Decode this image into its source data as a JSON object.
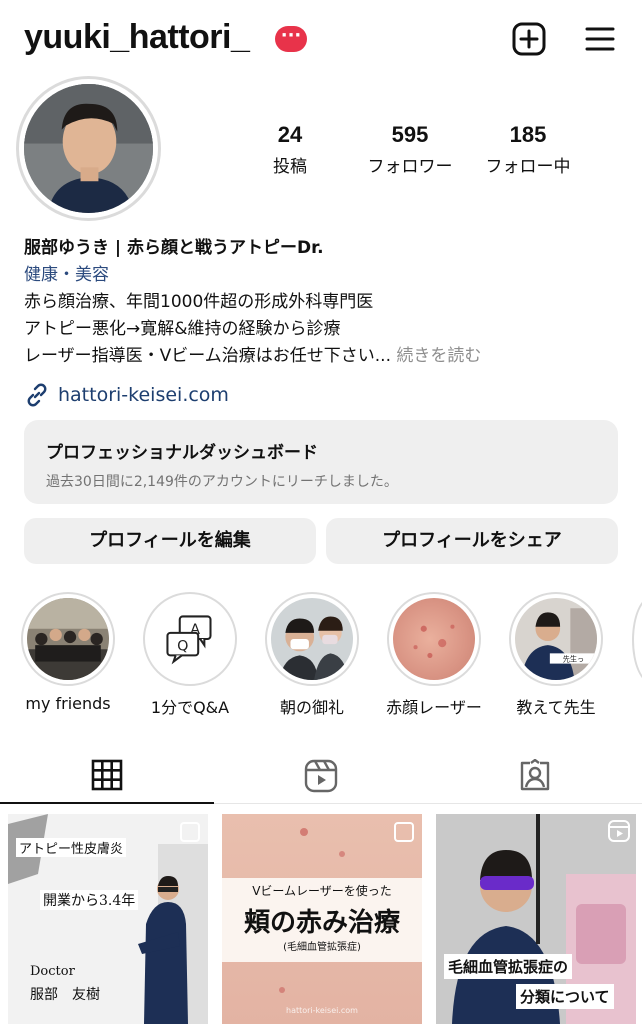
{
  "header": {
    "username": "yuuki_hattori_",
    "badge": "···",
    "badge_color": "#e8334a"
  },
  "stats": [
    {
      "value": "24",
      "label": "投稿"
    },
    {
      "value": "595",
      "label": "フォロワー"
    },
    {
      "value": "185",
      "label": "フォロー中"
    }
  ],
  "bio": {
    "name": "服部ゆうき | 赤ら顔と戦うアトピーDr.",
    "category": "健康・美容",
    "lines": [
      "赤ら顔治療、年間1000件超の形成外科専門医",
      "アトピー悪化→寛解&維持の経験から診療",
      "レーザー指導医・Vビーム治療はお任せ下さい..."
    ],
    "more": "続きを読む",
    "link": "hattori-keisei.com"
  },
  "dashboard": {
    "title": "プロフェッショナルダッシュボード",
    "subtitle": "過去30日間に2,149件のアカウントにリーチしました。"
  },
  "buttons": {
    "edit": "プロフィールを編集",
    "share": "プロフィールをシェア"
  },
  "highlights": [
    {
      "label": "my friends"
    },
    {
      "label": "1分でQ&A"
    },
    {
      "label": "朝の御礼"
    },
    {
      "label": "赤顔レーザー"
    },
    {
      "label": "教えて先生"
    }
  ],
  "posts": [
    {
      "lines": [
        "アトピー性皮膚炎",
        "開業から3.4年",
        "Doctor",
        "服部　友樹"
      ]
    },
    {
      "lines": [
        "Vビームレーザーを使った",
        "頬の赤み治療",
        "(毛細血管拡張症)",
        "hattori-keisei.com"
      ]
    },
    {
      "lines": [
        "毛細血管拡張症の",
        "分類について"
      ]
    }
  ]
}
